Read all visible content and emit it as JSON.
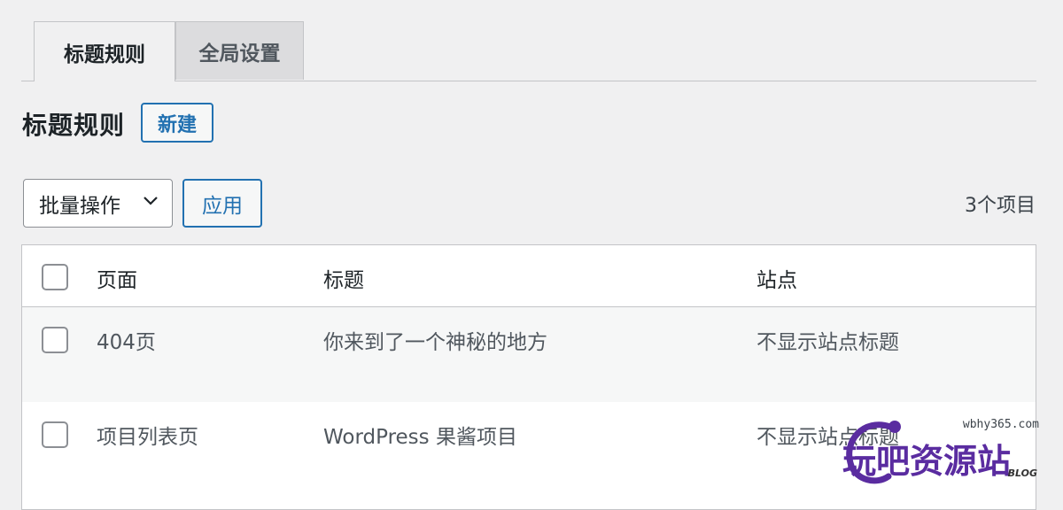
{
  "tabs": [
    {
      "label": "标题规则",
      "active": true
    },
    {
      "label": "全局设置",
      "active": false
    }
  ],
  "heading": {
    "title": "标题规则",
    "new_button": "新建"
  },
  "toolbar": {
    "bulk_action": "批量操作",
    "apply_button": "应用",
    "item_count": "3个项目"
  },
  "table": {
    "columns": [
      "页面",
      "标题",
      "站点"
    ],
    "rows": [
      {
        "page": "404页",
        "title": "你来到了一个神秘的地方",
        "site": "不显示站点标题"
      },
      {
        "page": "项目列表页",
        "title": "WordPress 果酱项目",
        "site": "不显示站点标题"
      }
    ]
  },
  "watermark": {
    "url": "wbhy365.com",
    "text": "玩吧资源站",
    "tag": "BLOG"
  },
  "colors": {
    "accent": "#2271b1",
    "background": "#f0f0f1",
    "watermark": "#5a2ca0"
  },
  "icons": {
    "select": "chevron-down-icon"
  }
}
